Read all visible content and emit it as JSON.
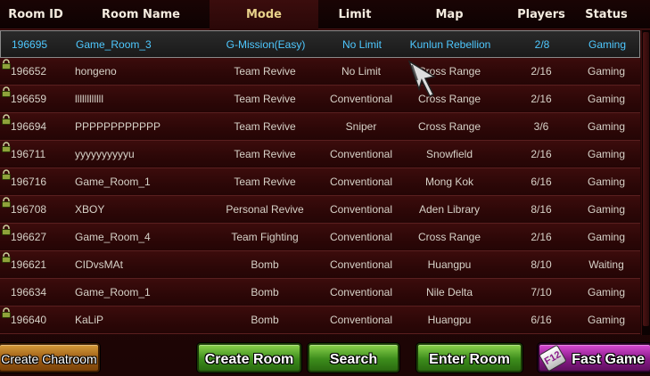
{
  "header": {
    "columns": [
      "Room ID",
      "Room Name",
      "Mode",
      "Limit",
      "Map",
      "Players",
      "Status"
    ],
    "active_column": "Mode"
  },
  "rooms": [
    {
      "id": "196695",
      "name": "Game_Room_3",
      "mode": "G-Mission(Easy)",
      "limit": "No Limit",
      "map": "Kunlun Rebellion",
      "players": "2/8",
      "status": "Gaming",
      "locked": false,
      "selected": true
    },
    {
      "id": "196652",
      "name": "hongeno",
      "mode": "Team Revive",
      "limit": "No Limit",
      "map": "Cross Range",
      "players": "2/16",
      "status": "Gaming",
      "locked": true,
      "selected": false
    },
    {
      "id": "196659",
      "name": "llllllllllll",
      "mode": "Team Revive",
      "limit": "Conventional",
      "map": "Cross Range",
      "players": "2/16",
      "status": "Gaming",
      "locked": true,
      "selected": false
    },
    {
      "id": "196694",
      "name": "PPPPPPPPPPPP",
      "mode": "Team Revive",
      "limit": "Sniper",
      "map": "Cross Range",
      "players": "3/6",
      "status": "Gaming",
      "locked": true,
      "selected": false
    },
    {
      "id": "196711",
      "name": "yyyyyyyyyyu",
      "mode": "Team Revive",
      "limit": "Conventional",
      "map": "Snowfield",
      "players": "2/16",
      "status": "Gaming",
      "locked": true,
      "selected": false
    },
    {
      "id": "196716",
      "name": "Game_Room_1",
      "mode": "Team Revive",
      "limit": "Conventional",
      "map": "Mong Kok",
      "players": "6/16",
      "status": "Gaming",
      "locked": true,
      "selected": false
    },
    {
      "id": "196708",
      "name": "XBOY",
      "mode": "Personal Revive",
      "limit": "Conventional",
      "map": "Aden Library",
      "players": "8/16",
      "status": "Gaming",
      "locked": true,
      "selected": false
    },
    {
      "id": "196627",
      "name": "Game_Room_4",
      "mode": "Team Fighting",
      "limit": "Conventional",
      "map": "Cross Range",
      "players": "2/16",
      "status": "Gaming",
      "locked": true,
      "selected": false
    },
    {
      "id": "196621",
      "name": "CIDvsMAt",
      "mode": "Bomb",
      "limit": "Conventional",
      "map": "Huangpu",
      "players": "8/10",
      "status": "Waiting",
      "locked": true,
      "selected": false
    },
    {
      "id": "196634",
      "name": "Game_Room_1",
      "mode": "Bomb",
      "limit": "Conventional",
      "map": "Nile Delta",
      "players": "7/10",
      "status": "Gaming",
      "locked": false,
      "selected": false
    },
    {
      "id": "196640",
      "name": "KaLiP",
      "mode": "Bomb",
      "limit": "Conventional",
      "map": "Huangpu",
      "players": "6/16",
      "status": "Gaming",
      "locked": true,
      "selected": false
    }
  ],
  "buttons": {
    "create_chatroom": "Create Chatroom",
    "create_room": "Create Room",
    "search": "Search",
    "enter_room": "Enter Room",
    "fast_game": "Fast Game",
    "fast_game_key": "F12"
  },
  "colors": {
    "selected_text": "#4ec8ff",
    "row_text": "#d7d2c8",
    "header_text": "#f4ece0",
    "active_header_text": "#e8d28a"
  }
}
